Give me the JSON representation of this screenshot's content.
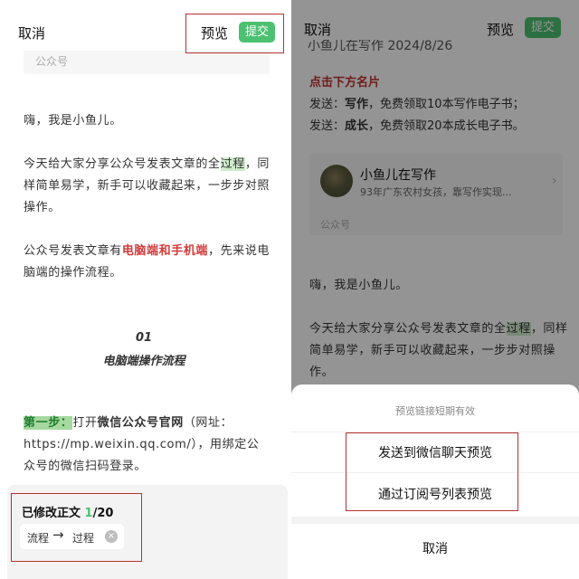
{
  "left": {
    "topbar": {
      "cancel": "取消",
      "preview": "预览",
      "submit": "提交"
    },
    "account_label": "公众号",
    "para1": "嗨，我是小鱼儿。",
    "para2": {
      "a": "今天给大家分享公众号发表文章的全",
      "highlight": "过程",
      "b": "，同样简单易学，新手可以收藏起来，一步步对照操作。"
    },
    "para3": {
      "a": "公众号发表文章有",
      "red": "电脑端和手机端",
      "b": "，先来说电脑端的操作流程。"
    },
    "section_number": "01",
    "section_title": "电脑端操作流程",
    "step": {
      "label": "第一步：",
      "a": "打开",
      "bold": "微信公众号官网",
      "b": "（网址：https://mp.weixin.qq.com/），用绑定公众号的微信扫码登录。"
    },
    "modify": {
      "title_prefix": "已修改正文 ",
      "count": "1",
      "total": "/20",
      "from": "流程",
      "arrow": "→",
      "to": "过程",
      "close": "×"
    }
  },
  "right": {
    "topbar": {
      "cancel": "取消",
      "preview": "预览",
      "submit": "提交"
    },
    "title_partial": "小鱼儿在写作  2024/8/26",
    "click_card": "点击下方名片",
    "line1": {
      "a": "发送：",
      "b": "写作",
      "c": "，免费领取10本写作电子书；"
    },
    "line2": {
      "a": "发送：",
      "b": "成长",
      "c": "，免费领取20本成长电子书。"
    },
    "card": {
      "name": "小鱼儿在写作",
      "desc": "93年广东农村女孩，靠写作实现...",
      "account": "公众号",
      "chevron": "›"
    },
    "para1": "嗨，我是小鱼儿。",
    "para2": {
      "a": "今天给大家分享公众号发表文章的全",
      "highlight": "过程",
      "b": "，同样简单易学，新手可以收藏起来，一步步对照操作。"
    },
    "sheet": {
      "tip": "预览链接短期有效",
      "option1": "发送到微信聊天预览",
      "option2": "通过订阅号列表预览",
      "cancel": "取消"
    }
  },
  "colors": {
    "accent": "#4cc071",
    "annotation_red": "#b8312f",
    "text_red": "#d23a3a"
  }
}
